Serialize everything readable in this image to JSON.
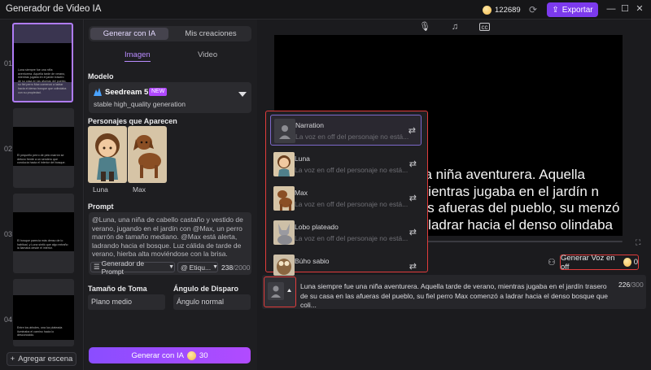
{
  "app": {
    "title": "Generador de Video IA",
    "credits": "122689",
    "export_label": "Exportar"
  },
  "scenes": {
    "items": [
      {
        "num": "01",
        "preview_text": "Luna siempre fue una niña aventurera. Aquella tarde de verano, mientras jugaba en el jardín trasero de su casa en las afueras del pueblo, su fiel perro Max comenzó a ladrar hacia el denso bosque que colindaba con su propiedad."
      },
      {
        "num": "02",
        "preview_text": "El pequeño perro de pelo marrón se detuvo frente a un sendero que conducía hacia el interior del bosque."
      },
      {
        "num": "03",
        "preview_text": "El bosque parecía más denso de lo habitual, y Luna sintió que algo extraño la llamaba desde el interior."
      },
      {
        "num": "04",
        "preview_text": "Entre los árboles, una luz plateada iluminaba el camino hacia lo desconocido."
      }
    ],
    "add_label": "Agregar escena"
  },
  "panel": {
    "tabs": [
      "Generar con IA",
      "Mis creaciones"
    ],
    "subtabs": [
      "Imagen",
      "Video"
    ],
    "model_label": "Modelo",
    "model_name": "Seedream 5.0",
    "model_badge": "NEW",
    "model_desc": "stable high_quality generation",
    "characters_label": "Personajes que Aparecen",
    "characters": [
      "Luna",
      "Max"
    ],
    "prompt_label": "Prompt",
    "prompt_text": "@Luna, una niña de cabello castaño y vestido de verano, jugando en el jardín con @Max, un perro marrón de tamaño mediano. @Max está alerta, ladrando hacia el bosque. Luz cálida de tarde de verano, hierba alta moviéndose con la brisa.",
    "prompt_gen_label": "Generador de Prompt",
    "prompt_tag_label": "Etiqu...",
    "prompt_count": "238",
    "prompt_max": "/2000",
    "shot_size_label": "Tamaño de Toma",
    "shot_size_value": "Plano medio",
    "angle_label": "Ángulo de Disparo",
    "angle_value": "Ángulo normal",
    "generate_label": "Generar con IA",
    "generate_cost": "30"
  },
  "preview": {
    "subtitle": "na niña aventurera. Aquella mientras jugaba en el jardín n las afueras del pueblo, su menzó a ladrar hacia el denso olindaba con su propiedad"
  },
  "voice": {
    "button_label": "Generar Voz en off",
    "button_cost": "0",
    "options": [
      {
        "name": "Narration",
        "desc": "La voz en off del personaje no está..."
      },
      {
        "name": "Luna",
        "desc": "La voz en off del personaje no está..."
      },
      {
        "name": "Max",
        "desc": "La voz en off del personaje no está..."
      },
      {
        "name": "Lobo plateado",
        "desc": "La voz en off del personaje no está..."
      },
      {
        "name": "Búho sabio",
        "desc": ""
      }
    ]
  },
  "narration": {
    "text": "Luna siempre fue una niña aventurera. Aquella tarde de verano, mientras jugaba en el jardín trasero de su casa en las afueras del pueblo, su fiel perro Max comenzó a ladrar hacia el denso bosque que coli...",
    "count": "226",
    "max": "/300"
  }
}
